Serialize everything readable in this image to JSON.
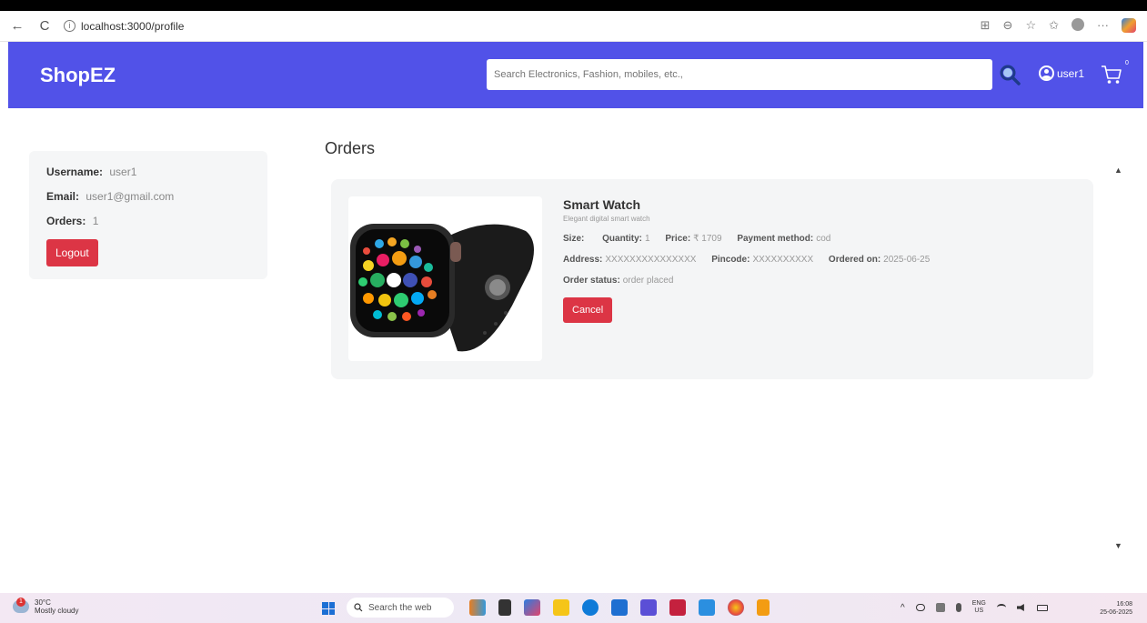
{
  "browser": {
    "url": "localhost:3000/profile",
    "back_icon": "←",
    "refresh_icon": "C",
    "info_icon": "i",
    "icons": [
      "⊞",
      "⊖",
      "☆",
      "✩",
      "···"
    ]
  },
  "header": {
    "brand": "ShopEZ",
    "search_placeholder": "Search Electronics, Fashion, mobiles, etc.,",
    "user_label": "user1",
    "cart_count": "0"
  },
  "profile": {
    "username_label": "Username:",
    "username": "user1",
    "email_label": "Email:",
    "email": "user1@gmail.com",
    "orders_label": "Orders:",
    "orders_count": "1",
    "logout_label": "Logout"
  },
  "orders": {
    "title": "Orders",
    "items": [
      {
        "name": "Smart Watch",
        "description": "Elegant digital smart watch",
        "size_label": "Size:",
        "size": "",
        "quantity_label": "Quantity:",
        "quantity": "1",
        "price_label": "Price:",
        "price": "₹ 1709",
        "payment_label": "Payment method:",
        "payment": "cod",
        "address_label": "Address:",
        "address": "XXXXXXXXXXXXXXX",
        "pincode_label": "Pincode:",
        "pincode": "XXXXXXXXXX",
        "ordered_label": "Ordered on:",
        "ordered_on": "2025-06-25",
        "status_label": "Order status:",
        "status": "order placed",
        "cancel_label": "Cancel"
      }
    ]
  },
  "scrollbar": {
    "up_icon": "▲",
    "down_icon": "▼"
  },
  "taskbar": {
    "weather_temp": "30°C",
    "weather_desc": "Mostly cloudy",
    "weather_badge": "1",
    "search_placeholder": "Search the web",
    "lang_line1": "ENG",
    "lang_line2": "US",
    "tray_up_icon": "^",
    "time": "16:08",
    "date": "25-06-2025"
  },
  "colors": {
    "nav_bg": "#5152e8",
    "danger": "#dc3545"
  }
}
